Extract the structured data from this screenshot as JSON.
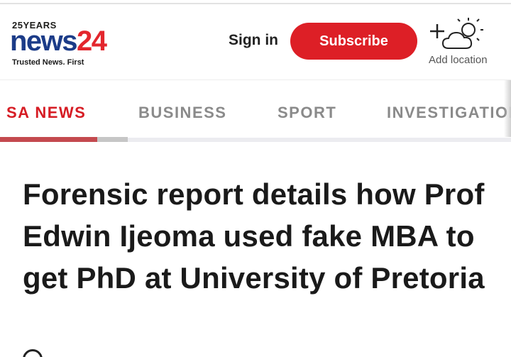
{
  "header": {
    "logo": {
      "years": "25YEARS",
      "word_news": "news",
      "word_num": "24",
      "tagline": "Trusted News. First"
    },
    "signin_label": "Sign in",
    "subscribe_label": "Subscribe",
    "weather": {
      "icon": "partly-cloudy-add-icon",
      "label": "Add location"
    }
  },
  "nav": {
    "items": [
      {
        "label": "SA NEWS",
        "active": true
      },
      {
        "label": "BUSINESS",
        "active": false
      },
      {
        "label": "SPORT",
        "active": false
      },
      {
        "label": "INVESTIGATIONS",
        "active": false
      }
    ],
    "active_color": "#d61c24"
  },
  "article": {
    "headline": "Forensic report details how Prof Edwin Ijeoma used fake MBA to get PhD at University of Pretoria"
  },
  "colors": {
    "brand_blue": "#1c3c88",
    "brand_red": "#dd1f26"
  }
}
